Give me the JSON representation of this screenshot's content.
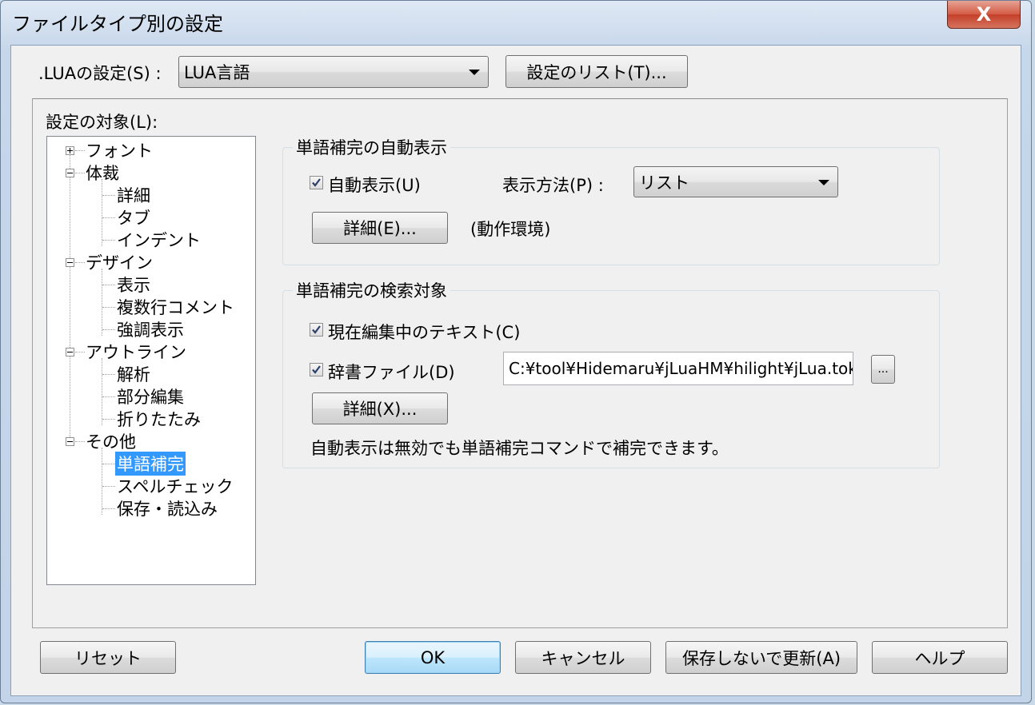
{
  "window": {
    "title": "ファイルタイプ別の設定",
    "close_label": "X"
  },
  "header": {
    "setting_label": ".LUAの設定(S) :",
    "setting_value": "LUA言語",
    "list_button": "設定のリスト(T)..."
  },
  "tree": {
    "label": "設定の対象(L):",
    "items": [
      "フォント",
      "体裁",
      "詳細",
      "タブ",
      "インデント",
      "デザイン",
      "表示",
      "複数行コメント",
      "強調表示",
      "アウトライン",
      "解析",
      "部分編集",
      "折りたたみ",
      "その他",
      "単語補完",
      "スペルチェック",
      "保存・読込み"
    ],
    "selected": "単語補完"
  },
  "auto_display": {
    "group_title": "単語補完の自動表示",
    "checkbox_label": "自動表示(U)",
    "checked": true,
    "method_label": "表示方法(P) :",
    "method_value": "リスト",
    "detail_button": "詳細(E)...",
    "note": "(動作環境)"
  },
  "search_target": {
    "group_title": "単語補完の検索対象",
    "current_text_label": "現在編集中のテキスト(C)",
    "current_text_checked": true,
    "dict_label": "辞書ファイル(D)",
    "dict_checked": true,
    "dict_path": "C:¥tool¥Hidemaru¥jLuaHM¥hilight¥jLua.tok",
    "browse_button": "...",
    "detail_button": "詳細(X)...",
    "note": "自動表示は無効でも単語補完コマンドで補完できます。"
  },
  "footer": {
    "reset": "リセット",
    "ok": "OK",
    "cancel": "キャンセル",
    "update_no_save": "保存しないで更新(A)",
    "help": "ヘルプ"
  }
}
